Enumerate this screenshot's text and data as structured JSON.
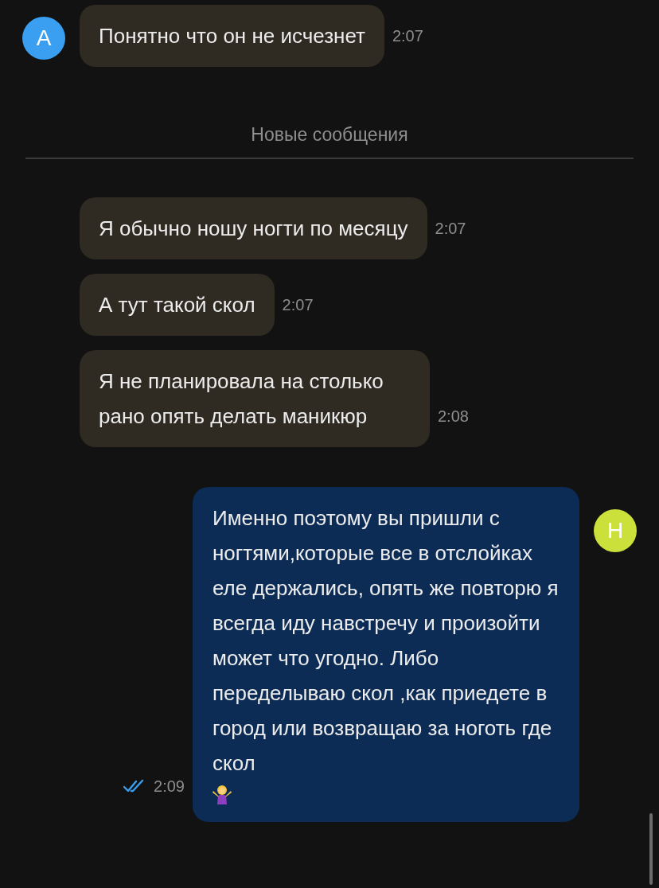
{
  "items": [
    {
      "kind": "incoming",
      "avatar": {
        "letter": "А",
        "color": "#3a9ff0"
      },
      "text": "Понятно что он не исчезнет",
      "time": "2:07"
    },
    {
      "kind": "divider",
      "text": "Новые сообщения"
    },
    {
      "kind": "incoming",
      "text": "Я обычно ношу ногти по месяцу",
      "time": "2:07"
    },
    {
      "kind": "incoming",
      "text": "А тут такой скол",
      "time": "2:07"
    },
    {
      "kind": "incoming",
      "text": "Я не планировала на столько рано опять делать маникюр",
      "time": "2:08"
    },
    {
      "kind": "outgoing",
      "avatar": {
        "letter": "Н",
        "color": "#cbe03a"
      },
      "text": "Именно поэтому вы пришли с ногтями,которые все в отслойках еле держались, опять же повторю я всегда иду навстречу и произойти может что угодно. Либо переделываю скол ,как приедете в город или возвращаю за ноготь где скол",
      "time": "2:09",
      "read": true
    }
  ]
}
